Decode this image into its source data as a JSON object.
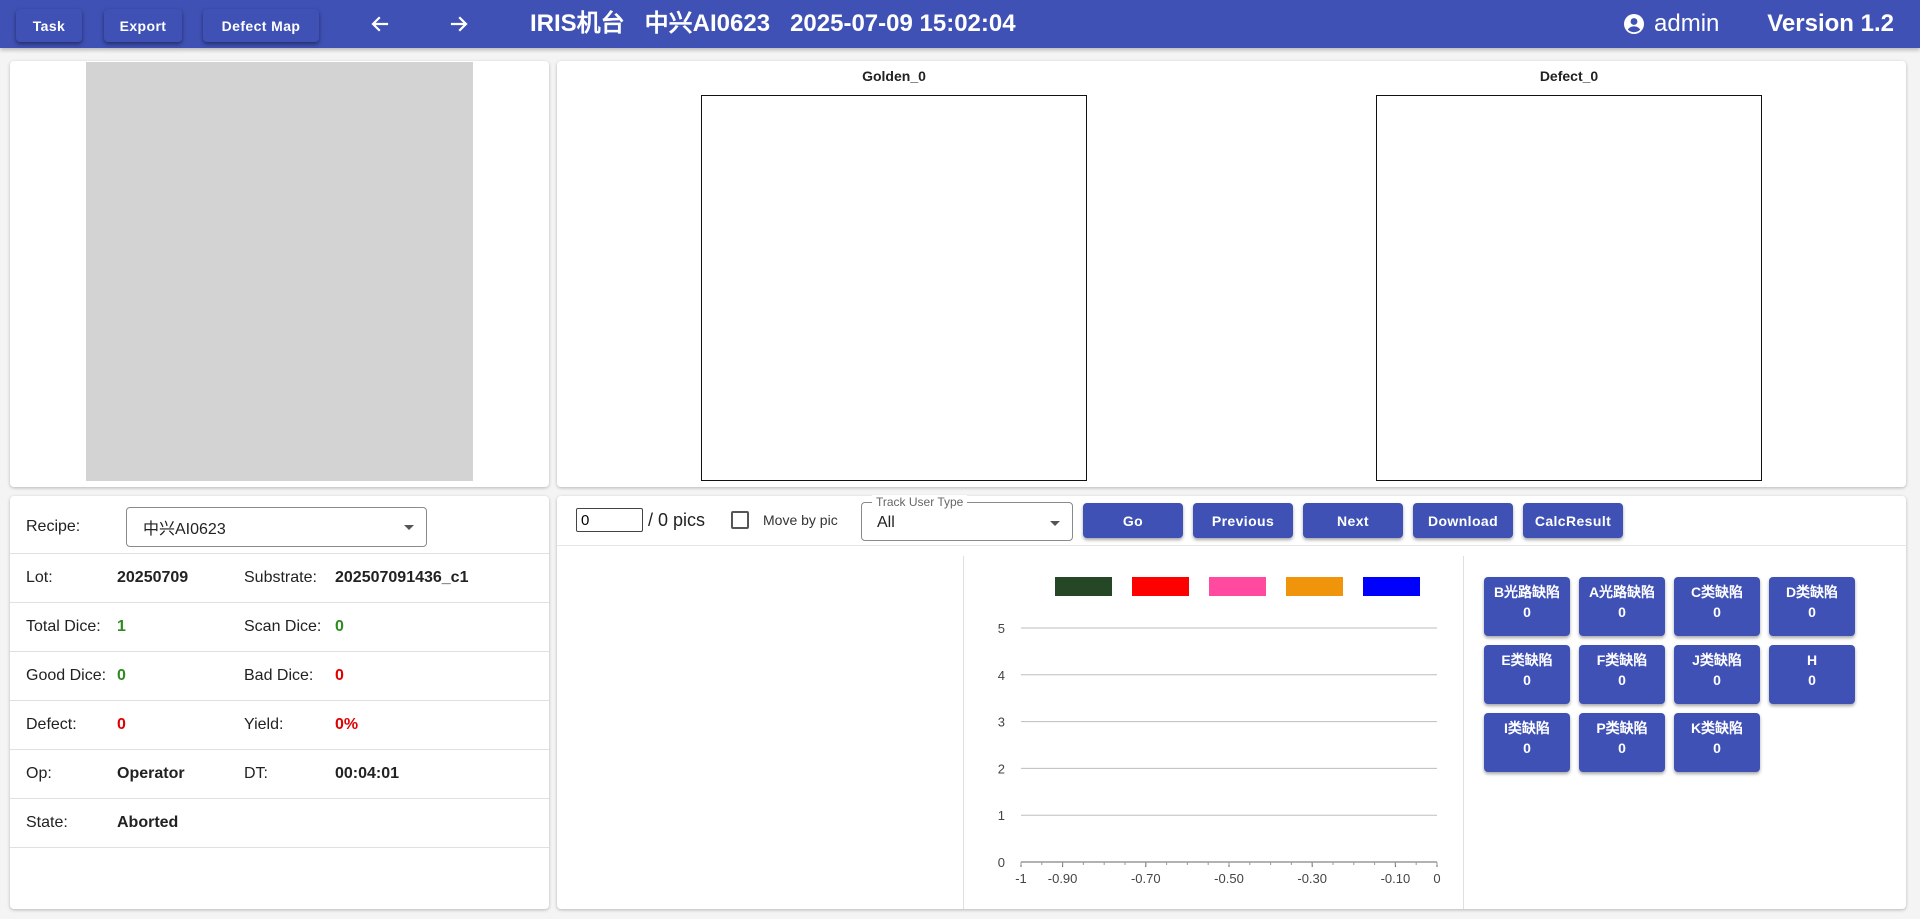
{
  "appbar": {
    "task_label": "Task",
    "export_label": "Export",
    "defect_map_label": "Defect Map",
    "title": "IRIS机台   中兴AI0623   2025-07-09 15:02:04",
    "user": "admin",
    "version": "Version 1.2",
    "color": "#3f51b5"
  },
  "images": {
    "golden_title": "Golden_0",
    "defect_title": "Defect_0"
  },
  "info": {
    "recipe_label": "Recipe:",
    "recipe_value": "中兴AI0623",
    "lot_label": "Lot:",
    "lot_value": "20250709",
    "substrate_label": "Substrate:",
    "substrate_value": "202507091436_c1",
    "total_dice_label": "Total Dice:",
    "total_dice_value": "1",
    "scan_dice_label": "Scan Dice:",
    "scan_dice_value": "0",
    "good_dice_label": "Good Dice:",
    "good_dice_value": "0",
    "bad_dice_label": "Bad Dice:",
    "bad_dice_value": "0",
    "defect_label": "Defect:",
    "defect_value": "0",
    "yield_label": "Yield:",
    "yield_value": "0%",
    "op_label": "Op:",
    "op_value": "Operator",
    "dt_label": "DT:",
    "dt_value": "00:04:01",
    "state_label": "State:",
    "state_value": "Aborted"
  },
  "controls": {
    "page_value": "0",
    "pics_label": "/ 0 pics",
    "move_by_pic_label": "Move by pic",
    "track_user_type_label": "Track User Type",
    "track_user_type_value": "All",
    "go_label": "Go",
    "previous_label": "Previous",
    "next_label": "Next",
    "download_label": "Download",
    "calc_result_label": "CalcResult"
  },
  "chart_data": {
    "type": "bar",
    "legend_colors": [
      "#264726",
      "#ff0000",
      "#ff4aa0",
      "#f0940b",
      "#0000ff"
    ],
    "x_ticks": [
      "-1",
      "-0.90",
      "-0.70",
      "-0.50",
      "-0.30",
      "-0.10",
      "0"
    ],
    "y_ticks": [
      "0",
      "1",
      "2",
      "3",
      "4",
      "5"
    ],
    "xlim": [
      -1,
      0
    ],
    "ylim": [
      0,
      5
    ],
    "grid": true,
    "legend_position": "top",
    "series": []
  },
  "defects": [
    {
      "name": "B光路缺陷",
      "count": "0"
    },
    {
      "name": "A光路缺陷",
      "count": "0"
    },
    {
      "name": "C类缺陷",
      "count": "0"
    },
    {
      "name": "D类缺陷",
      "count": "0"
    },
    {
      "name": "E类缺陷",
      "count": "0"
    },
    {
      "name": "F类缺陷",
      "count": "0"
    },
    {
      "name": "J类缺陷",
      "count": "0"
    },
    {
      "name": "H",
      "count": "0"
    },
    {
      "name": "I类缺陷",
      "count": "0"
    },
    {
      "name": "P类缺陷",
      "count": "0"
    },
    {
      "name": "K类缺陷",
      "count": "0"
    }
  ]
}
